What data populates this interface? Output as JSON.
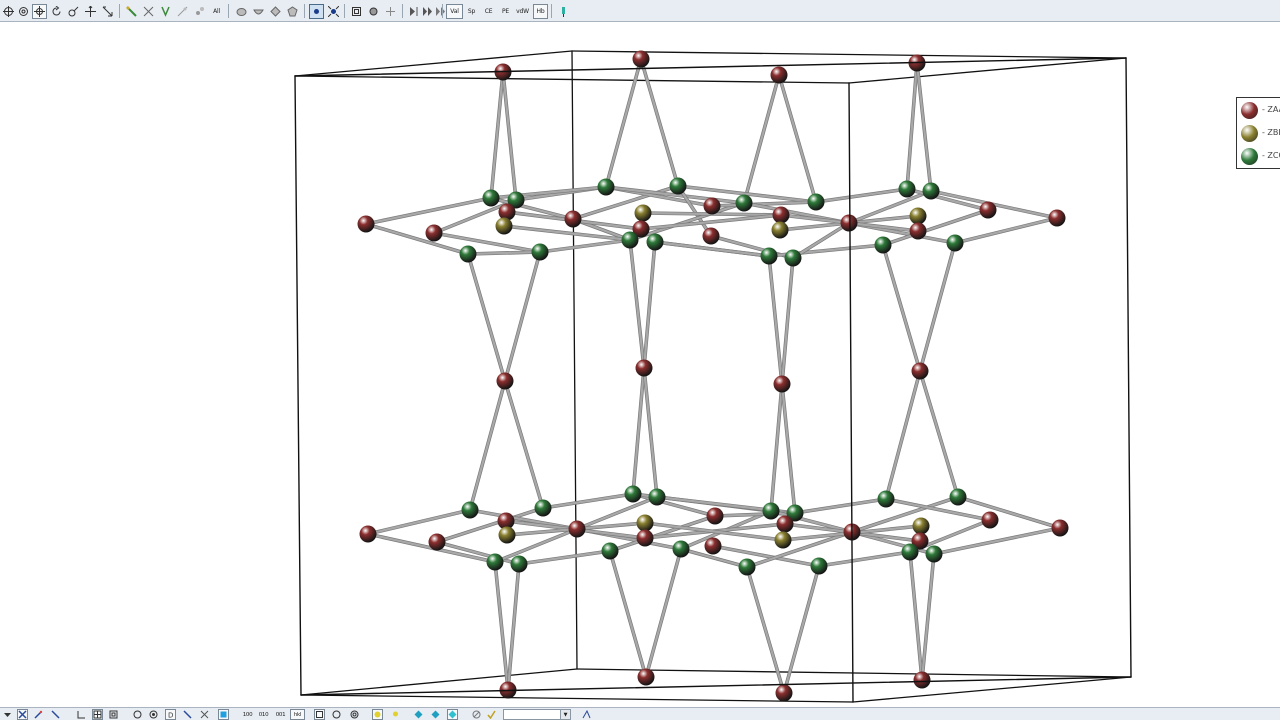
{
  "toolbar_top": {
    "labels": {
      "all": "All",
      "val": "Val",
      "sp": "Sp",
      "ce": "CE",
      "pe": "PE",
      "vdw": "vdW",
      "hb": "Hb"
    }
  },
  "toolbar_bottom": {
    "labels": {
      "plane_100": "100",
      "plane_010": "010",
      "plane_001": "001",
      "plane_hkl": "hkl"
    },
    "combo_value": ""
  },
  "legend": {
    "items": [
      {
        "label": "- ZAA",
        "color": "#8b2e2e"
      },
      {
        "label": "- ZBB",
        "color": "#8a8030"
      },
      {
        "label": "- ZCC",
        "color": "#2f7a3a"
      }
    ]
  },
  "structure": {
    "colors": {
      "ZAA": "#8b2e2e",
      "ZBB": "#8a8030",
      "ZCC": "#2f7a3a",
      "bond": "#a8a8a8",
      "cell": "#111111"
    }
  }
}
